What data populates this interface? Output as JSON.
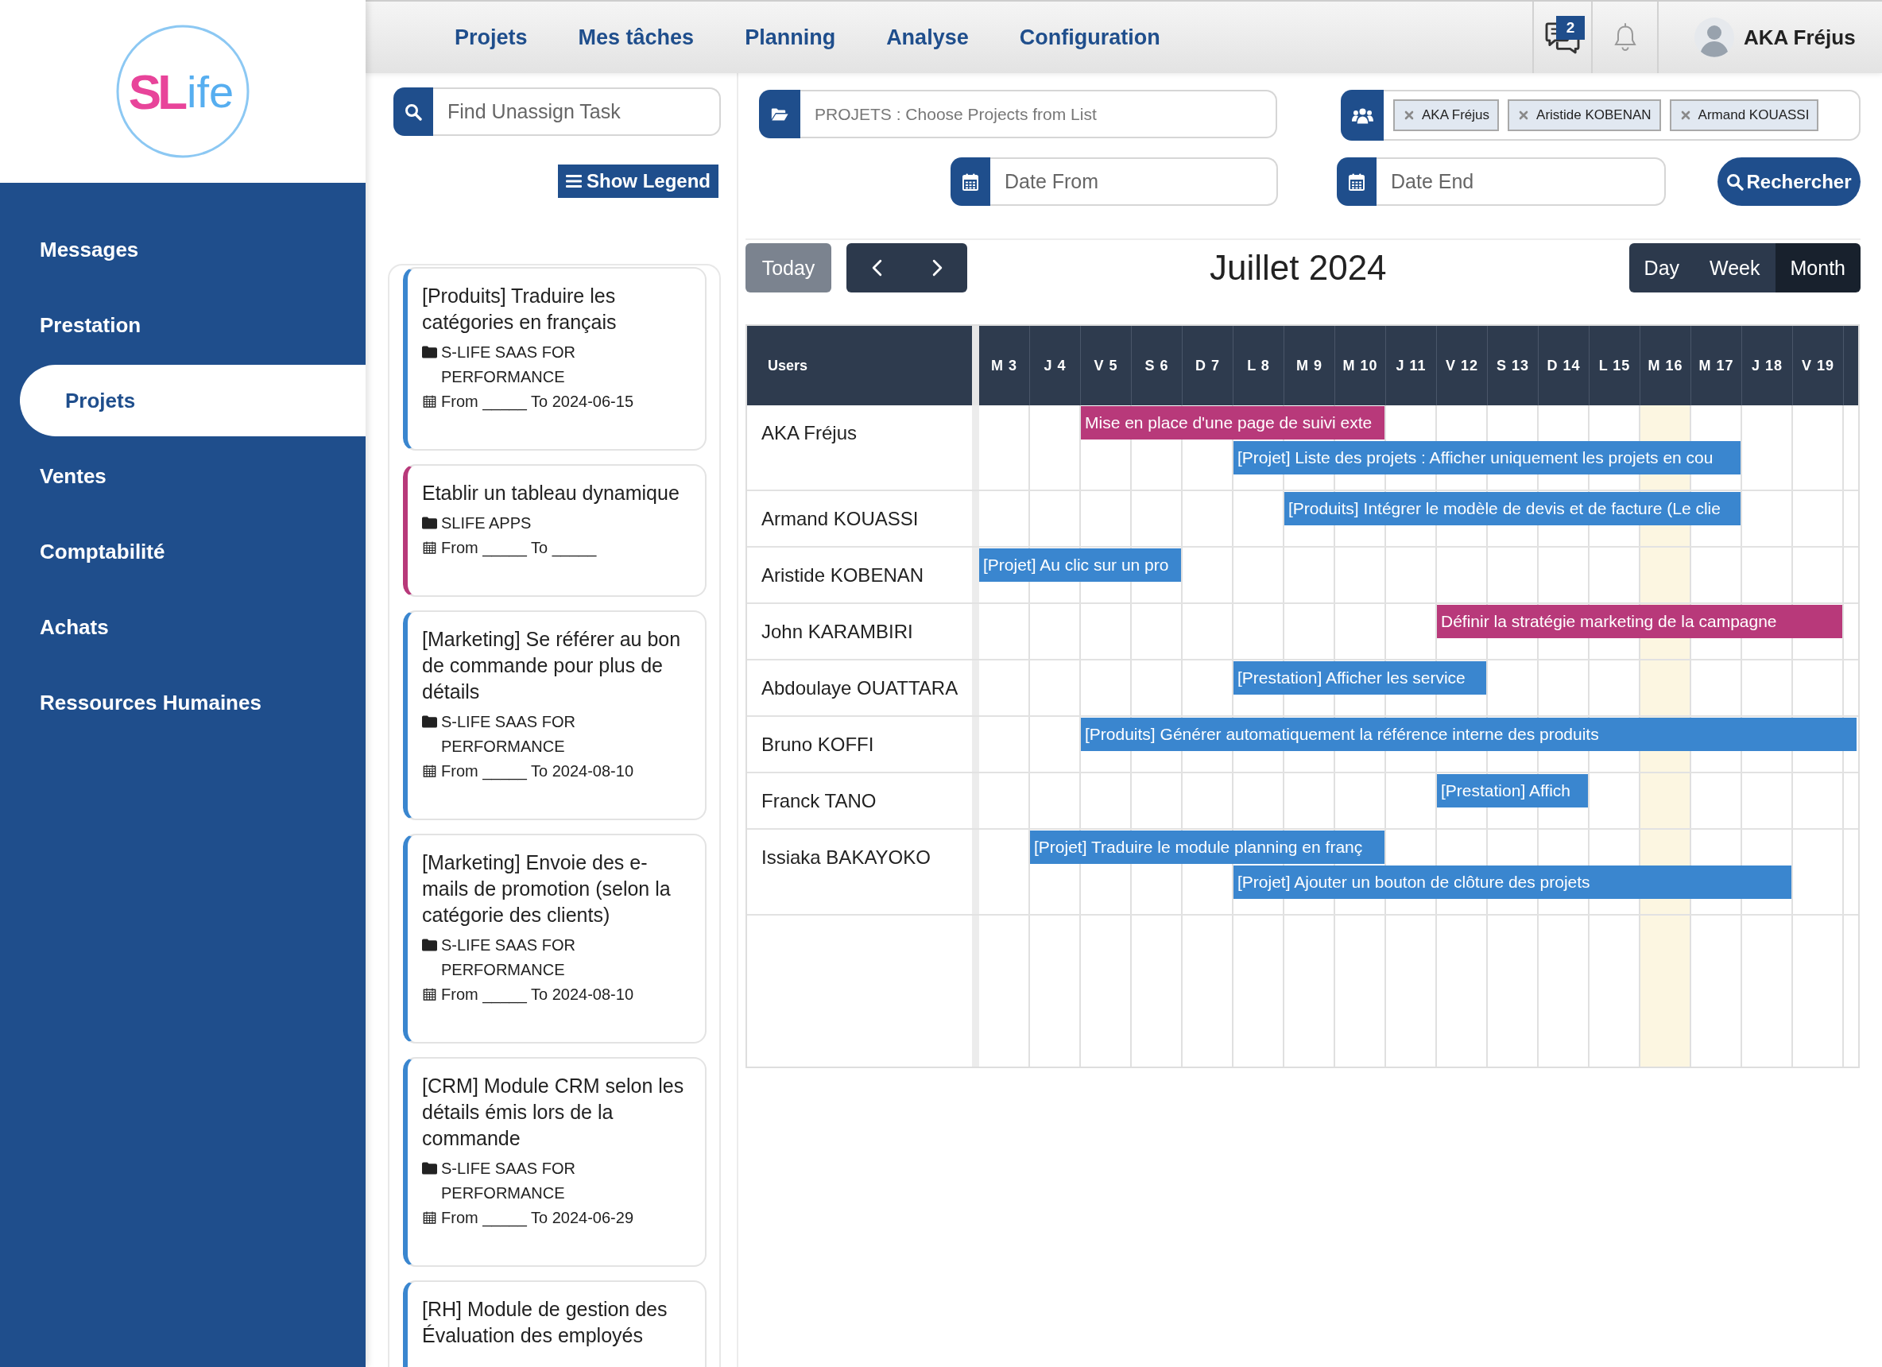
{
  "logo": {
    "mark": "SL",
    "text": "ife"
  },
  "sidebar": {
    "items": [
      {
        "label": "Messages",
        "selected": false
      },
      {
        "label": "Prestation",
        "selected": false
      },
      {
        "label": "Projets",
        "selected": true
      },
      {
        "label": "Ventes",
        "selected": false
      },
      {
        "label": "Comptabilité",
        "selected": false
      },
      {
        "label": "Achats",
        "selected": false
      },
      {
        "label": "Ressources Humaines",
        "selected": false
      }
    ]
  },
  "top_bar": {
    "links": [
      "Projets",
      "Mes tâches",
      "Planning",
      "Analyse",
      "Configuration"
    ],
    "messages_badge": "2",
    "user": {
      "name": "AKA Fréjus"
    }
  },
  "unassigned_tasks": {
    "search": {
      "placeholder": "Find Unassign Task"
    },
    "legend_button": "Show Legend",
    "cards": [
      {
        "title": "[Produits] Traduire les catégories en français",
        "project": "S-LIFE SAAS FOR PERFORMANCE",
        "dates": "From _____ To 2024-06-15",
        "color": "#3a86cf"
      },
      {
        "title": "Etablir un tableau dynamique",
        "project": "SLIFE APPS",
        "dates": "From _____ To _____",
        "color": "#b8397a"
      },
      {
        "title": "[Marketing] Se référer au bon de commande pour plus de détails",
        "project": "S-LIFE SAAS FOR PERFORMANCE",
        "dates": "From _____ To 2024-08-10",
        "color": "#3a86cf"
      },
      {
        "title": "[Marketing] Envoie des e-mails de promotion (selon la catégorie des clients)",
        "project": "S-LIFE SAAS FOR PERFORMANCE",
        "dates": "From _____ To 2024-08-10",
        "color": "#3a86cf"
      },
      {
        "title": "[CRM] Module CRM selon les détails émis lors de la commande",
        "project": "S-LIFE SAAS FOR PERFORMANCE",
        "dates": "From _____ To 2024-06-29",
        "color": "#3a86cf"
      },
      {
        "title": "[RH] Module de gestion des Évaluation des employés",
        "color": "#3a86cf"
      }
    ]
  },
  "filters": {
    "projects": {
      "placeholder": "PROJETS : Choose Projects from List"
    },
    "users": {
      "tags": [
        "AKA Fréjus",
        "Aristide KOBENAN",
        "Armand KOUASSI"
      ]
    },
    "date_from": {
      "placeholder": "Date From"
    },
    "date_end": {
      "placeholder": "Date End"
    },
    "search_button": "Rechercher"
  },
  "calendar": {
    "today_button": {
      "label": "Today",
      "disabled": true
    },
    "title": "Juillet 2024",
    "views": [
      {
        "label": "Day",
        "selected": false
      },
      {
        "label": "Week",
        "selected": false
      },
      {
        "label": "Month",
        "selected": true
      }
    ],
    "gantt": {
      "users_header": "Users",
      "days": [
        {
          "label": "M 3",
          "today": false
        },
        {
          "label": "J 4",
          "today": false
        },
        {
          "label": "V 5",
          "today": false
        },
        {
          "label": "S 6",
          "today": false
        },
        {
          "label": "D 7",
          "today": false
        },
        {
          "label": "L 8",
          "today": false
        },
        {
          "label": "M 9",
          "today": false
        },
        {
          "label": "M 10",
          "today": false
        },
        {
          "label": "J 11",
          "today": false
        },
        {
          "label": "V 12",
          "today": false
        },
        {
          "label": "S 13",
          "today": false
        },
        {
          "label": "D 14",
          "today": false
        },
        {
          "label": "L 15",
          "today": false
        },
        {
          "label": "M 16",
          "today": true
        },
        {
          "label": "M 17",
          "today": false
        },
        {
          "label": "J 18",
          "today": false
        },
        {
          "label": "V 19",
          "today": false
        }
      ],
      "rows": [
        {
          "user": "AKA Fréjus",
          "lanes": [
            [
              {
                "kind": "empty"
              },
              {
                "kind": "empty"
              },
              {
                "kind": "bar",
                "title": "Mise en place d'une page de suivi exte",
                "color": "#b8397a"
              },
              {
                "kind": "bar_more"
              },
              {
                "kind": "bar_more"
              },
              {
                "kind": "bar_more"
              },
              {
                "kind": "bar_more"
              },
              {
                "kind": "bar_more"
              }
            ],
            [
              {
                "kind": "empty"
              },
              {
                "kind": "empty"
              },
              {
                "kind": "empty"
              },
              {
                "kind": "empty"
              },
              {
                "kind": "empty"
              },
              {
                "kind": "bar",
                "title": "[Projet] Liste des projets : Afficher uniquement les projets en cou",
                "color": "#3a86cf"
              },
              {
                "kind": "bar_more"
              },
              {
                "kind": "bar_more"
              },
              {
                "kind": "bar_more"
              },
              {
                "kind": "bar_more"
              },
              {
                "kind": "bar_more"
              },
              {
                "kind": "bar_more"
              },
              {
                "kind": "bar_more"
              },
              {
                "kind": "bar_more"
              },
              {
                "kind": "bar_more"
              }
            ]
          ]
        },
        {
          "user": "Armand KOUASSI",
          "lanes": [
            [
              {
                "kind": "empty"
              },
              {
                "kind": "empty"
              },
              {
                "kind": "empty"
              },
              {
                "kind": "empty"
              },
              {
                "kind": "empty"
              },
              {
                "kind": "empty"
              },
              {
                "kind": "bar",
                "title": "[Produits] Intégrer le modèle de devis et de facture (Le clie",
                "color": "#3a86cf"
              },
              {
                "kind": "bar_more"
              },
              {
                "kind": "bar_more"
              },
              {
                "kind": "bar_more"
              },
              {
                "kind": "bar_more"
              },
              {
                "kind": "bar_more"
              },
              {
                "kind": "bar_more"
              },
              {
                "kind": "bar_more"
              },
              {
                "kind": "bar_more"
              }
            ]
          ]
        },
        {
          "user": "Aristide KOBENAN",
          "lanes": [
            [
              {
                "kind": "bar",
                "title": "[Projet] Au clic sur un pro",
                "color": "#3a86cf"
              },
              {
                "kind": "bar_more"
              },
              {
                "kind": "bar_more"
              },
              {
                "kind": "bar_more"
              }
            ]
          ]
        },
        {
          "user": "John KARAMBIRI",
          "lanes": [
            [
              {
                "kind": "empty"
              },
              {
                "kind": "empty"
              },
              {
                "kind": "empty"
              },
              {
                "kind": "empty"
              },
              {
                "kind": "empty"
              },
              {
                "kind": "empty"
              },
              {
                "kind": "empty"
              },
              {
                "kind": "empty"
              },
              {
                "kind": "empty"
              },
              {
                "kind": "bar",
                "title": "Définir la stratégie marketing de la campagne",
                "color": "#b8397a"
              },
              {
                "kind": "bar_more"
              },
              {
                "kind": "bar_more"
              },
              {
                "kind": "bar_more"
              },
              {
                "kind": "bar_more"
              },
              {
                "kind": "bar_more"
              },
              {
                "kind": "bar_more"
              },
              {
                "kind": "bar_more"
              }
            ]
          ]
        },
        {
          "user": "Abdoulaye OUATTARA",
          "lanes": [
            [
              {
                "kind": "empty"
              },
              {
                "kind": "empty"
              },
              {
                "kind": "empty"
              },
              {
                "kind": "empty"
              },
              {
                "kind": "empty"
              },
              {
                "kind": "bar",
                "title": "[Prestation] Afficher les service",
                "color": "#3a86cf"
              },
              {
                "kind": "bar_more"
              },
              {
                "kind": "bar_more"
              },
              {
                "kind": "bar_more"
              },
              {
                "kind": "bar_more"
              }
            ]
          ]
        },
        {
          "user": "Bruno KOFFI",
          "lanes": [
            [
              {
                "kind": "empty"
              },
              {
                "kind": "empty"
              },
              {
                "kind": "bar",
                "title": "[Produits] Générer automatiquement la référence interne des produits",
                "color": "#3a86cf"
              },
              {
                "kind": "bar_more"
              },
              {
                "kind": "bar_more"
              },
              {
                "kind": "bar_more"
              },
              {
                "kind": "bar_more"
              },
              {
                "kind": "bar_more"
              },
              {
                "kind": "bar_more"
              },
              {
                "kind": "bar_more"
              },
              {
                "kind": "bar_more"
              },
              {
                "kind": "bar_more"
              },
              {
                "kind": "bar_more"
              },
              {
                "kind": "bar_more"
              },
              {
                "kind": "bar_more"
              },
              {
                "kind": "bar_more"
              },
              {
                "kind": "bar_more"
              },
              {
                "kind": "bar_more"
              }
            ]
          ]
        },
        {
          "user": "Franck TANO",
          "lanes": [
            [
              {
                "kind": "empty"
              },
              {
                "kind": "empty"
              },
              {
                "kind": "empty"
              },
              {
                "kind": "empty"
              },
              {
                "kind": "empty"
              },
              {
                "kind": "empty"
              },
              {
                "kind": "empty"
              },
              {
                "kind": "empty"
              },
              {
                "kind": "empty"
              },
              {
                "kind": "bar",
                "title": "[Prestation] Affich",
                "color": "#3a86cf"
              },
              {
                "kind": "bar_more"
              },
              {
                "kind": "bar_more"
              }
            ]
          ]
        },
        {
          "user": "Issiaka BAKAYOKO",
          "lanes": [
            [
              {
                "kind": "empty"
              },
              {
                "kind": "bar",
                "title": "[Projet] Traduire le module planning en franç",
                "color": "#3a86cf"
              },
              {
                "kind": "bar_more"
              },
              {
                "kind": "bar_more"
              },
              {
                "kind": "bar_more"
              },
              {
                "kind": "bar_more"
              },
              {
                "kind": "bar_more"
              },
              {
                "kind": "bar_more"
              }
            ],
            [
              {
                "kind": "empty"
              },
              {
                "kind": "empty"
              },
              {
                "kind": "empty"
              },
              {
                "kind": "empty"
              },
              {
                "kind": "empty"
              },
              {
                "kind": "bar",
                "title": "[Projet] Ajouter un bouton de clôture des projets",
                "color": "#3a86cf"
              },
              {
                "kind": "bar_more"
              },
              {
                "kind": "bar_more"
              },
              {
                "kind": "bar_more"
              },
              {
                "kind": "bar_more"
              },
              {
                "kind": "bar_more"
              },
              {
                "kind": "bar_more"
              },
              {
                "kind": "bar_more"
              },
              {
                "kind": "bar_more"
              },
              {
                "kind": "bar_more"
              },
              {
                "kind": "bar_more"
              }
            ]
          ]
        }
      ]
    }
  }
}
